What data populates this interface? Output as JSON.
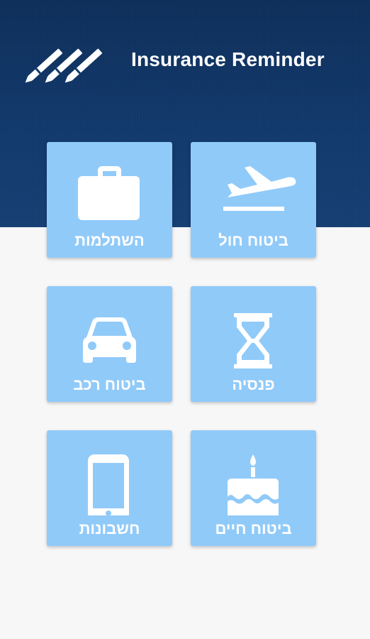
{
  "app": {
    "title": "Insurance Reminder"
  },
  "tiles": [
    {
      "label": "השתלמות",
      "icon": "briefcase-icon"
    },
    {
      "label": "ביטוח חול",
      "icon": "airplane-takeoff-icon"
    },
    {
      "label": "ביטוח רכב",
      "icon": "car-icon"
    },
    {
      "label": "פנסיה",
      "icon": "hourglass-icon"
    },
    {
      "label": "חשבונות",
      "icon": "smartphone-icon"
    },
    {
      "label": "ביטוח חיים",
      "icon": "birthday-cake-icon"
    }
  ],
  "colors": {
    "header": "#12396b",
    "tile": "#90caf9",
    "background": "#f7f7f8",
    "icon": "#ffffff"
  }
}
